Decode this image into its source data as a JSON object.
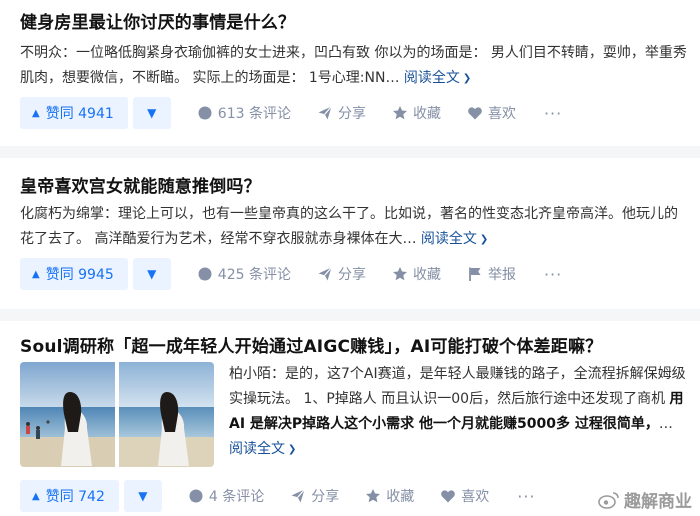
{
  "feed": [
    {
      "title": "健身房里最让你讨厌的事情是什么？",
      "author": "不明众：",
      "excerpt": "一位略低胸紧身衣瑜伽裤的女士进来，凹凸有致 你以为的场面是： 男人们目不转睛，耍帅，举重秀肌肉，想要微信，不断瞄。 实际上的场面是： 1号心理:NN…",
      "read_more": "阅读全文",
      "vote_up": "赞同 4941",
      "comments": "613 条评论",
      "share": "分享",
      "favorite": "收藏",
      "like": "喜欢",
      "more": "···"
    },
    {
      "title": "皇帝喜欢宫女就能随意推倒吗？",
      "author": "化腐朽为绵掌：",
      "excerpt": "理论上可以，也有一些皇帝真的这么干了。比如说，著名的性变态北齐皇帝高洋。他玩儿的花了去了。 高洋酷爱行为艺术，经常不穿衣服就赤身裸体在大…",
      "read_more": "阅读全文",
      "vote_up": "赞同 9945",
      "comments": "425 条评论",
      "share": "分享",
      "favorite": "收藏",
      "report": "举报",
      "more": "···"
    },
    {
      "title": "Soul调研称「超一成年轻人开始通过AIGC赚钱」，AI可能打破个体差距嘛？",
      "author": "柏小陌：",
      "excerpt_plain": "是的，这7个AI赛道，是年轻人最赚钱的路子，全流程拆解保姆级实操玩法。 1、P掉路人 而且认识一00后，然后旅行途中还发现了商机 ",
      "excerpt_bold": "用AI 是解决P掉路人这个小需求 他一个月就能赚5000多 过程很简单，",
      "excerpt_tail": "…",
      "read_more": "阅读全文",
      "vote_up": "赞同 742",
      "comments": "4 条评论",
      "share": "分享",
      "favorite": "收藏",
      "like": "喜欢",
      "more": "···"
    }
  ],
  "watermark": "趣解商业",
  "colors": {
    "accent": "#1772f6",
    "vote_bg": "#eaf3ff",
    "muted": "#8590a6",
    "link": "#175199"
  }
}
